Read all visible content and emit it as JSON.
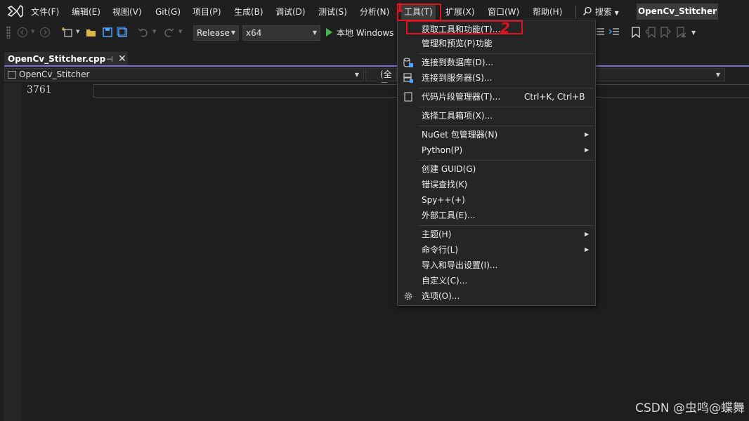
{
  "menubar": {
    "items": [
      "文件(F)",
      "编辑(E)",
      "视图(V)",
      "Git(G)",
      "项目(P)",
      "生成(B)",
      "调试(D)",
      "测试(S)",
      "分析(N)",
      "工具(T)",
      "扩展(X)",
      "窗口(W)",
      "帮助(H)"
    ],
    "search_label": "搜索",
    "solution_name": "OpenCv_Stitcher"
  },
  "toolbar": {
    "configuration": "Release",
    "platform": "x64",
    "run_label": "本地 Windows"
  },
  "editor": {
    "tab_name": "OpenCv_Stitcher.cpp",
    "nav_project": "OpenCv_Stitcher",
    "nav_scope": "(全局",
    "line_number": "3761"
  },
  "tools_menu": {
    "items": [
      {
        "label": "获取工具和功能(T)...",
        "shortcut": "",
        "submenu": false,
        "icon": ""
      },
      {
        "label": "管理和预览(P)功能",
        "shortcut": "",
        "submenu": false,
        "icon": ""
      },
      {
        "label": "连接到数据库(D)...",
        "shortcut": "",
        "submenu": false,
        "icon": "database-connect-icon"
      },
      {
        "label": "连接到服务器(S)...",
        "shortcut": "",
        "submenu": false,
        "icon": "server-connect-icon"
      },
      {
        "label": "代码片段管理器(T)...",
        "shortcut": "Ctrl+K, Ctrl+B",
        "submenu": false,
        "icon": "snippet-icon"
      },
      {
        "label": "选择工具箱项(X)...",
        "shortcut": "",
        "submenu": false,
        "icon": ""
      },
      {
        "label": "NuGet 包管理器(N)",
        "shortcut": "",
        "submenu": true,
        "icon": ""
      },
      {
        "label": "Python(P)",
        "shortcut": "",
        "submenu": true,
        "icon": ""
      },
      {
        "label": "创建 GUID(G)",
        "shortcut": "",
        "submenu": false,
        "icon": ""
      },
      {
        "label": "错误查找(K)",
        "shortcut": "",
        "submenu": false,
        "icon": ""
      },
      {
        "label": "Spy++(+)",
        "shortcut": "",
        "submenu": false,
        "icon": ""
      },
      {
        "label": "外部工具(E)...",
        "shortcut": "",
        "submenu": false,
        "icon": ""
      },
      {
        "label": "主题(H)",
        "shortcut": "",
        "submenu": true,
        "icon": ""
      },
      {
        "label": "命令行(L)",
        "shortcut": "",
        "submenu": true,
        "icon": ""
      },
      {
        "label": "导入和导出设置(I)...",
        "shortcut": "",
        "submenu": false,
        "icon": ""
      },
      {
        "label": "自定义(C)...",
        "shortcut": "",
        "submenu": false,
        "icon": ""
      },
      {
        "label": "选项(O)...",
        "shortcut": "",
        "submenu": false,
        "icon": "gear-icon"
      }
    ]
  },
  "annotations": {
    "step1": "1",
    "step2": "2",
    "color": "#e0121f"
  },
  "watermark": "CSDN @虫鸣@蝶舞",
  "colors": {
    "background": "#1f1f1f",
    "menu_background": "#252526",
    "tab_accent": "#7a6fd8",
    "run_green": "#3fb950"
  }
}
